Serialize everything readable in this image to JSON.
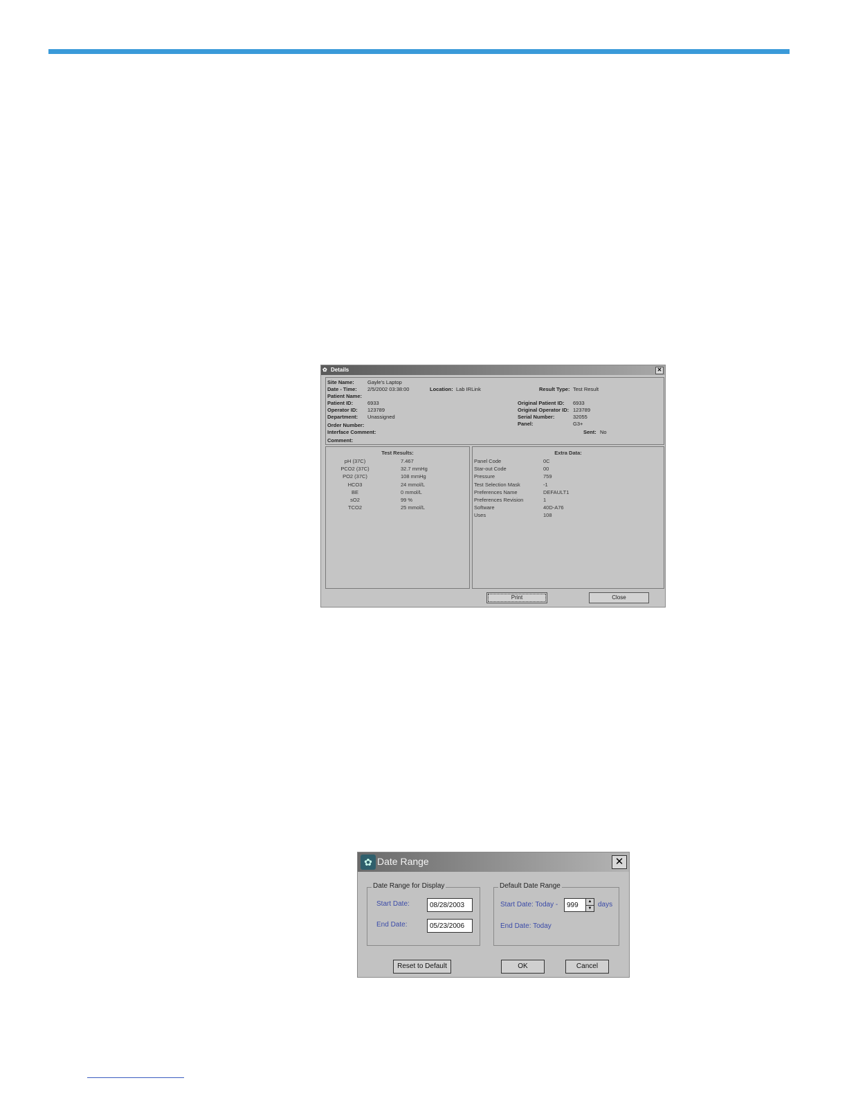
{
  "details": {
    "title": "Details",
    "info": {
      "site_name_label": "Site Name:",
      "site_name": "Gayle's Laptop",
      "date_time_label": "Date - Time:",
      "date_time": "2/5/2002 03:38:00",
      "location_label": "Location:",
      "location": "Lab IRLink",
      "result_type_label": "Result Type:",
      "result_type": "Test Result",
      "patient_name_label": "Patient Name:",
      "patient_id_label": "Patient ID:",
      "patient_id": "6933",
      "orig_patient_id_label": "Original Patient ID:",
      "orig_patient_id": "6933",
      "operator_id_label": "Operator ID:",
      "operator_id": "123789",
      "orig_operator_id_label": "Original Operator ID:",
      "orig_operator_id": "123789",
      "department_label": "Department:",
      "department": "Unassigned",
      "serial_number_label": "Serial Number:",
      "serial_number": "32055",
      "order_number_label": "Order Number:",
      "panel_label": "Panel:",
      "panel": "G3+",
      "interface_comment_label": "Interface Comment:",
      "sent_label": "Sent:",
      "sent": "No",
      "comment_label": "Comment:"
    },
    "test_results": {
      "header": "Test Results:",
      "rows": [
        {
          "name": "pH (37C)",
          "value": "7.467"
        },
        {
          "name": "PCO2 (37C)",
          "value": "32.7 mmHg"
        },
        {
          "name": "PO2 (37C)",
          "value": "108 mmHg"
        },
        {
          "name": "HCO3",
          "value": "24 mmol/L"
        },
        {
          "name": "BE",
          "value": "0 mmol/L"
        },
        {
          "name": "sO2",
          "value": "99 %"
        },
        {
          "name": "TCO2",
          "value": "25 mmol/L"
        }
      ]
    },
    "extra_data": {
      "header": "Extra Data:",
      "rows": [
        {
          "name": "Panel Code",
          "value": "0C"
        },
        {
          "name": "Star-out Code",
          "value": "00"
        },
        {
          "name": "Pressure",
          "value": "759"
        },
        {
          "name": "Test Selection Mask",
          "value": "-1"
        },
        {
          "name": "Preferences Name",
          "value": "DEFAULT1"
        },
        {
          "name": "Preferences Revision",
          "value": "1"
        },
        {
          "name": "Software",
          "value": "40D-A76"
        },
        {
          "name": "Uses",
          "value": "108"
        }
      ]
    },
    "print_label": "Print",
    "close_label": "Close"
  },
  "date_range": {
    "title": "Date Range",
    "display_group": "Date Range for Display",
    "start_date_label": "Start Date:",
    "start_date": "08/28/2003",
    "end_date_label": "End Date:",
    "end_date": "05/23/2006",
    "default_group": "Default Date Range",
    "default_start_label": "Start Date: Today  -",
    "days_value": "999",
    "days_label": "days",
    "default_end_label": "End Date:  Today",
    "reset_label": "Reset to Default",
    "ok_label": "OK",
    "cancel_label": "Cancel"
  }
}
